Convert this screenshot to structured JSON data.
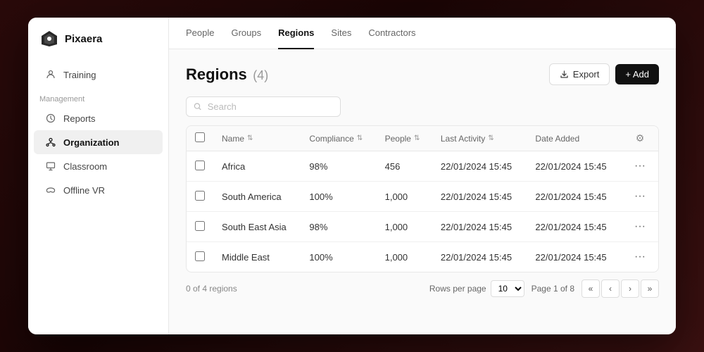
{
  "logo": {
    "text": "Pixaera"
  },
  "sidebar": {
    "items": [
      {
        "id": "training",
        "label": "Training",
        "icon": "person-icon"
      },
      {
        "id": "reports",
        "label": "Reports",
        "icon": "clock-icon"
      },
      {
        "id": "organization",
        "label": "Organization",
        "icon": "org-icon",
        "active": true
      },
      {
        "id": "classroom",
        "label": "Classroom",
        "icon": "monitor-icon"
      },
      {
        "id": "offline-vr",
        "label": "Offline VR",
        "icon": "vr-icon"
      }
    ],
    "section_label": "Management"
  },
  "tabs": [
    {
      "id": "people",
      "label": "People"
    },
    {
      "id": "groups",
      "label": "Groups"
    },
    {
      "id": "regions",
      "label": "Regions",
      "active": true
    },
    {
      "id": "sites",
      "label": "Sites"
    },
    {
      "id": "contractors",
      "label": "Contractors"
    }
  ],
  "page": {
    "title": "Regions",
    "count": "(4)",
    "export_label": "Export",
    "add_label": "+ Add",
    "search_placeholder": "Search"
  },
  "table": {
    "columns": [
      {
        "id": "name",
        "label": "Name",
        "sortable": true
      },
      {
        "id": "compliance",
        "label": "Compliance",
        "sortable": true
      },
      {
        "id": "people",
        "label": "People",
        "sortable": true
      },
      {
        "id": "last_activity",
        "label": "Last Activity",
        "sortable": true
      },
      {
        "id": "date_added",
        "label": "Date Added",
        "sortable": false
      }
    ],
    "rows": [
      {
        "name": "Africa",
        "compliance": "98%",
        "people": "456",
        "last_activity": "22/01/2024 15:45",
        "date_added": "22/01/2024 15:45"
      },
      {
        "name": "South America",
        "compliance": "100%",
        "people": "1,000",
        "last_activity": "22/01/2024 15:45",
        "date_added": "22/01/2024 15:45"
      },
      {
        "name": "South East Asia",
        "compliance": "98%",
        "people": "1,000",
        "last_activity": "22/01/2024 15:45",
        "date_added": "22/01/2024 15:45"
      },
      {
        "name": "Middle East",
        "compliance": "100%",
        "people": "1,000",
        "last_activity": "22/01/2024 15:45",
        "date_added": "22/01/2024 15:45"
      }
    ]
  },
  "pagination": {
    "info": "0 of 4 regions",
    "rows_per_page_label": "Rows per page",
    "rows_per_page_value": "10",
    "page_info": "Page 1 of 8"
  }
}
